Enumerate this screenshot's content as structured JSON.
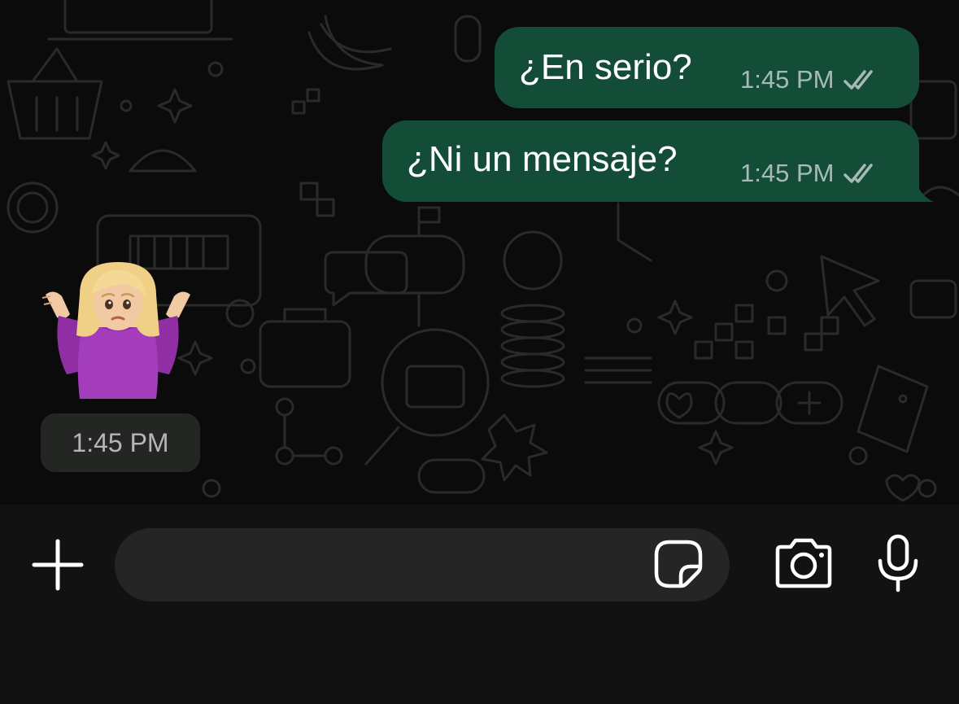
{
  "messages": [
    {
      "direction": "outgoing",
      "text": "¿En serio?",
      "time": "1:45 PM",
      "status_icon": "double-check-icon"
    },
    {
      "direction": "outgoing",
      "text": "¿Ni un mensaje?",
      "time": "1:45 PM",
      "status_icon": "double-check-icon"
    },
    {
      "direction": "incoming",
      "sticker": "woman-shrugging-sticker",
      "time": "1:45 PM"
    }
  ],
  "composer": {
    "placeholder": "",
    "value": "",
    "icons": [
      "plus-icon",
      "sticker-icon",
      "camera-icon",
      "microphone-icon"
    ]
  },
  "colors": {
    "outgoing_bubble": "#134d37",
    "incoming_timestamp_bg": "#242624",
    "chat_background": "#0b0b0b",
    "input_bar_background": "#121212",
    "input_field_background": "#252525"
  }
}
